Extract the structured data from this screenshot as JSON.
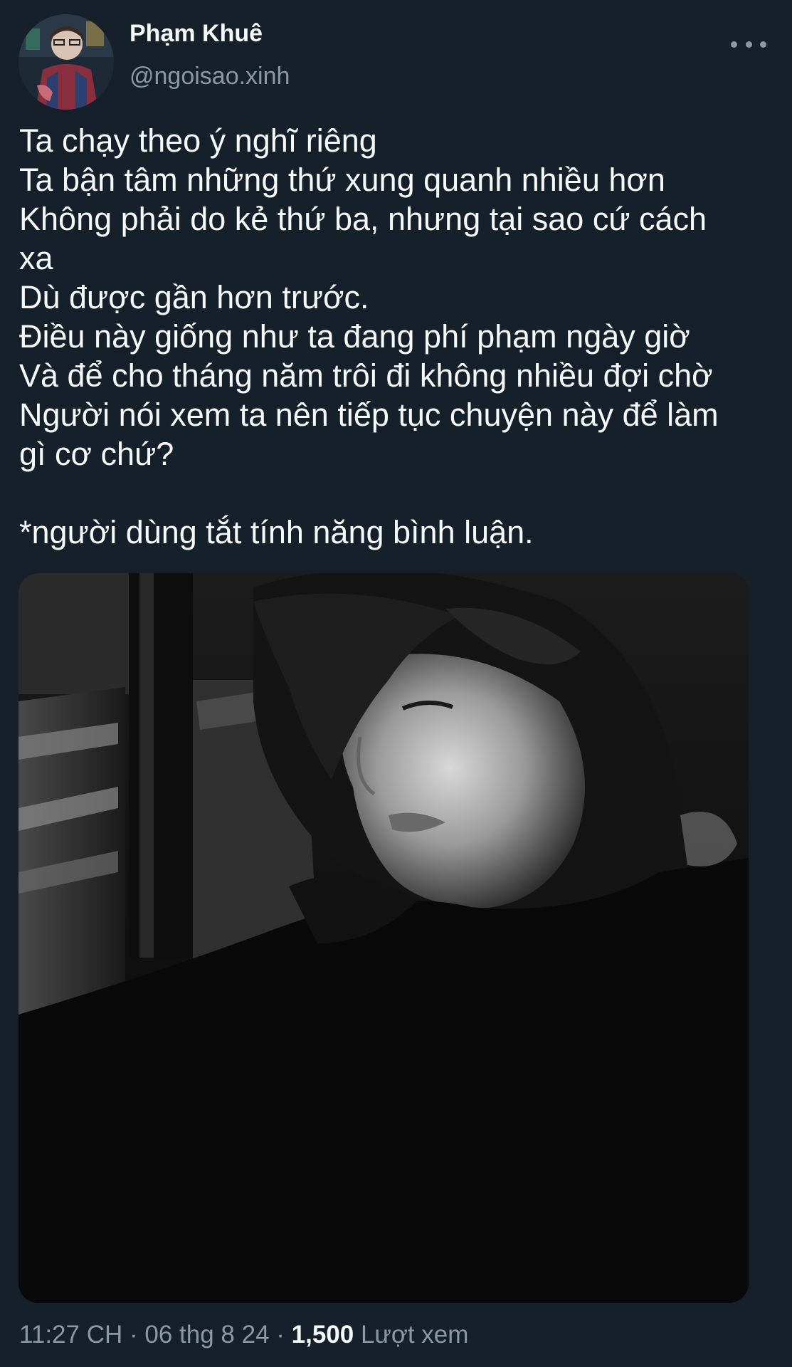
{
  "author": {
    "display_name": "Phạm Khuê",
    "handle": "@ngoisao.xinh"
  },
  "tweet": {
    "lines": [
      "Ta chạy theo ý nghĩ riêng",
      "Ta bận tâm những thứ xung quanh nhiều hơn",
      "Không phải do kẻ thứ ba, nhưng tại sao cứ cách",
      "xa",
      "Dù được gần hơn trước.",
      "Điều này giống như ta đang phí phạm ngày giờ",
      "Và để cho tháng năm trôi đi không nhiều đợi chờ",
      "Người nói xem ta nên tiếp tục chuyện này để làm",
      "gì cơ chứ?",
      "*người dùng tắt tính năng bình luận."
    ]
  },
  "meta": {
    "time": "11:27 CH",
    "separator": " · ",
    "date": "06 thg 8 24",
    "views_count": "1,500",
    "views_label": "Lượt xem"
  },
  "icons": {
    "more": "more-dots-icon"
  },
  "colors": {
    "background": "#15202b",
    "primary_text": "#f7f9f9",
    "secondary_text": "#8b98a5"
  }
}
